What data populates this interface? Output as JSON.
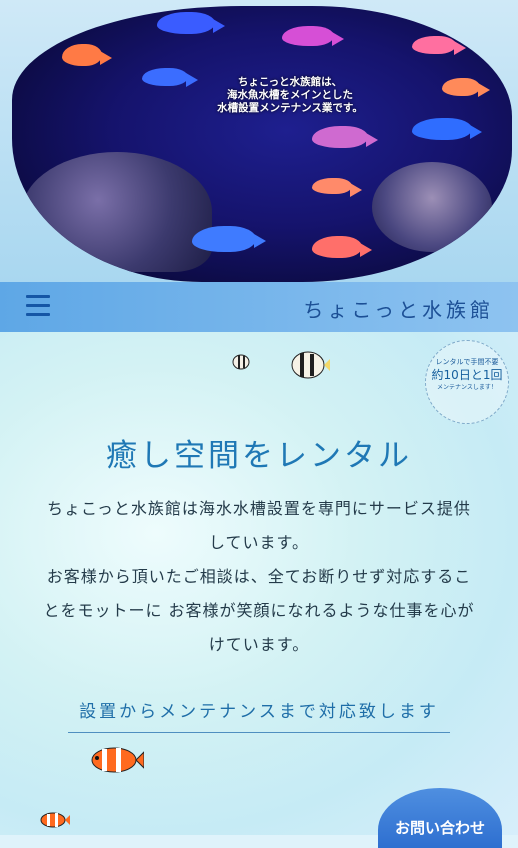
{
  "hero": {
    "caption_line1": "ちょこっと水族館は、",
    "caption_line2": "海水魚水槽をメインとした",
    "caption_line3": "水槽設置メンテナンス業です。"
  },
  "navbar": {
    "site_title": "ちょこっと水族館",
    "menu_icon": "hamburger-menu-icon"
  },
  "stamp": {
    "line1": "レンタルで手間不要",
    "line2": "約10日と1回",
    "line3": "メンテナンスします！"
  },
  "main": {
    "heading": "癒し空間をレンタル",
    "paragraph1_line1": "ちょこっと水族館は海水水槽設置を専門にサービス提供",
    "paragraph1_line2": "しています。",
    "paragraph2_line1": "お客様から頂いたご相談は、全てお断りせず対応するこ",
    "paragraph2_line2": "とをモットーに お客様が笑顔になれるような仕事を心が",
    "paragraph2_line3": "けています。",
    "subheading": "設置からメンテナンスまで対応致します"
  },
  "contact": {
    "label": "お問い合わせ"
  },
  "colors": {
    "accent": "#1f78b5",
    "navbar": "#5ea7e6",
    "contact_button": "#2e6fd0"
  }
}
